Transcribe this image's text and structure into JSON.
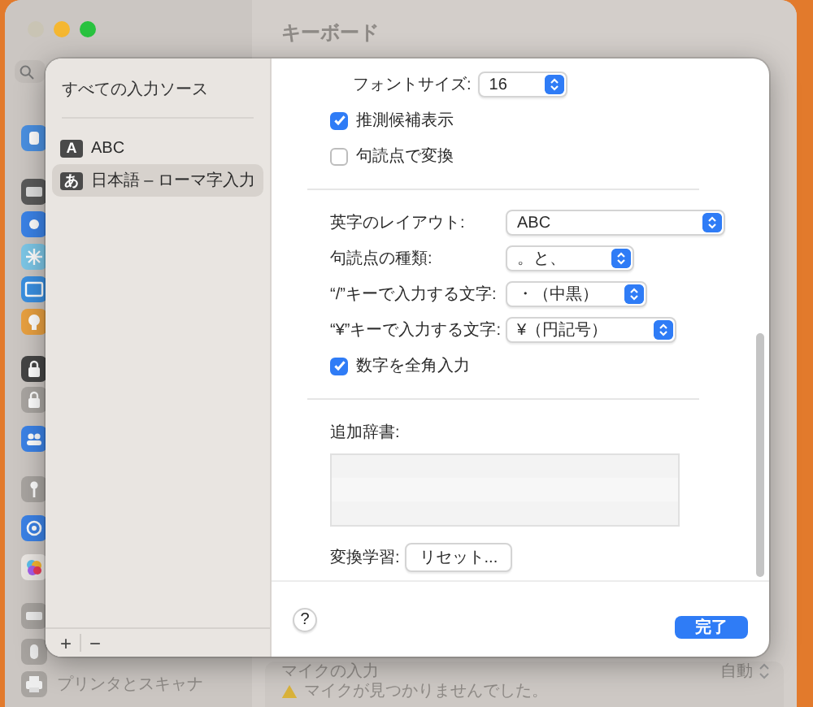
{
  "background": {
    "title": "キーボード",
    "sidebar_last_item": "プリンタとスキャナ",
    "mic": {
      "label": "マイクの入力",
      "value": "自動",
      "warning": "マイクが見つかりませんでした。"
    }
  },
  "sheet": {
    "sources_title": "すべての入力ソース",
    "sources": [
      {
        "badge": "A",
        "label": "ABC",
        "selected": false
      },
      {
        "badge": "あ",
        "label": "日本語 – ローマ字入力",
        "selected": true
      }
    ],
    "add_button": "+",
    "remove_button": "−",
    "font_size": {
      "label": "フォントサイズ:",
      "value": "16"
    },
    "options_top": [
      {
        "label": "推測候補表示",
        "checked": true
      },
      {
        "label": "句読点で変換",
        "checked": false
      }
    ],
    "popups": [
      {
        "label": "英字のレイアウト:",
        "value": "ABC"
      },
      {
        "label": "句読点の種類:",
        "value": "。と、"
      },
      {
        "label": "“/”キーで入力する文字:",
        "value": "・（中黒）"
      },
      {
        "label": "“¥”キーで入力する文字:",
        "value": "¥（円記号）"
      }
    ],
    "options_bottom": [
      {
        "label": "数字を全角入力",
        "checked": true
      }
    ],
    "dictionary": {
      "label": "追加辞書:"
    },
    "learning": {
      "label": "変換学習:",
      "button": "リセット..."
    },
    "help": "?",
    "done": "完了"
  }
}
